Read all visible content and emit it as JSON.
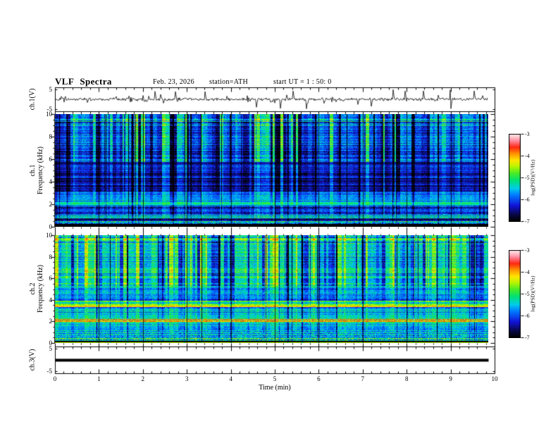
{
  "chart_data": {
    "type": "heatmap",
    "title": "VLF Spectra",
    "date": "Feb. 23, 2026",
    "station": "station=ATH",
    "start_ut": "start UT =  1 : 50: 0",
    "xlabel": "Time  (min)",
    "xlim": [
      0,
      10
    ],
    "xticks": [
      0,
      1,
      2,
      3,
      4,
      5,
      6,
      7,
      8,
      9,
      10
    ],
    "x_minor_step": 0.2,
    "data_duration_min": 9.85,
    "panels": [
      {
        "id": "ch1-waveform",
        "type": "line",
        "ylabel": "ch.1(V)",
        "ylim": [
          -6,
          6
        ],
        "yticks": [
          5,
          -5
        ],
        "description": "broadband noise around 0 V, ~±1 V, with sporadic impulses to ±5 V",
        "signal": {
          "baseline": 0,
          "noise_amp": 0.5,
          "spike_count": 26,
          "spike_amp_min": 1.5,
          "spike_amp_max": 5,
          "seed": 7
        }
      },
      {
        "id": "ch1-spectrogram",
        "type": "heatmap",
        "ylabel_lines": [
          "ch.1",
          "Frequency (kHz)"
        ],
        "ylim": [
          0,
          10
        ],
        "yticks": [
          0,
          2,
          4,
          6,
          8,
          10
        ],
        "y_minor_step": 0.5,
        "value_range": [
          -7,
          -3
        ],
        "seed": 11,
        "stripe_sign": 1,
        "bands": [
          [
            0.0,
            0.25,
            -7.0,
            0.1,
            0.0
          ],
          [
            0.25,
            0.5,
            -4.9,
            0.95,
            0.1
          ],
          [
            0.5,
            0.75,
            -6.3,
            0.5,
            0.1
          ],
          [
            0.75,
            1.05,
            -5.35,
            0.45,
            0.2
          ],
          [
            1.05,
            1.85,
            -5.9,
            0.5,
            0.3
          ],
          [
            1.85,
            2.15,
            -4.95,
            0.35,
            0.2
          ],
          [
            2.15,
            2.6,
            -5.55,
            0.35,
            0.3
          ],
          [
            2.6,
            3.1,
            -5.75,
            0.4,
            0.4
          ],
          [
            3.1,
            4.4,
            -6.45,
            0.35,
            0.5
          ],
          [
            4.4,
            5.5,
            -6.3,
            0.4,
            0.55
          ],
          [
            5.5,
            5.75,
            -6.6,
            0.3,
            0.35
          ],
          [
            5.75,
            9.0,
            -6.05,
            0.45,
            0.95
          ],
          [
            9.0,
            10.0,
            -5.65,
            0.55,
            0.95
          ]
        ]
      },
      {
        "id": "ch2-spectrogram",
        "type": "heatmap",
        "ylabel_lines": [
          "ch.2",
          "Frequency (kHz)"
        ],
        "ylim": [
          0,
          10
        ],
        "yticks": [
          0,
          2,
          4,
          6,
          8,
          10
        ],
        "y_minor_step": 0.5,
        "value_range": [
          -7,
          -3
        ],
        "seed": 23,
        "stripe_sign": -1,
        "bands": [
          [
            0.0,
            0.08,
            -4.4,
            0.3,
            0.0
          ],
          [
            0.08,
            0.2,
            -7.0,
            0.15,
            0.0
          ],
          [
            0.2,
            0.55,
            -5.3,
            0.85,
            0.1
          ],
          [
            0.55,
            1.1,
            -5.35,
            0.7,
            0.15
          ],
          [
            1.1,
            1.95,
            -5.45,
            0.45,
            0.25
          ],
          [
            1.95,
            2.25,
            -4.15,
            0.5,
            0.1
          ],
          [
            2.25,
            3.35,
            -5.35,
            0.45,
            0.3
          ],
          [
            3.35,
            3.6,
            -4.35,
            0.45,
            0.15
          ],
          [
            3.6,
            3.95,
            -5.0,
            0.4,
            0.25
          ],
          [
            3.95,
            4.65,
            -5.85,
            0.5,
            0.35
          ],
          [
            4.65,
            5.3,
            -5.5,
            0.45,
            0.45
          ],
          [
            5.3,
            9.2,
            -5.25,
            0.45,
            0.9
          ],
          [
            9.2,
            10.0,
            -5.0,
            0.6,
            0.85
          ]
        ]
      },
      {
        "id": "ch3-waveform",
        "type": "line",
        "ylabel": "ch.3(V)",
        "ylim": [
          -6,
          6
        ],
        "yticks": [
          5,
          -5
        ],
        "description": "flat line at 0 V (no signal), drawn thick",
        "signal": {
          "baseline": 0,
          "noise_amp": 0,
          "spike_count": 0,
          "line_width": 4,
          "seed": 3
        }
      }
    ],
    "colorbars": [
      {
        "label": "log(PSD)(V²/Hz)",
        "range": [
          -7,
          -3
        ],
        "ticks": [
          -3,
          -4,
          -5,
          -6,
          -7
        ]
      },
      {
        "label": "log(PSD)(V²/Hz)",
        "range": [
          -7,
          -3
        ],
        "ticks": [
          -3,
          -4,
          -5,
          -6,
          -7
        ]
      }
    ],
    "colormap": [
      [
        0.0,
        [
          0,
          0,
          0
        ]
      ],
      [
        0.08,
        [
          8,
          8,
          70
        ]
      ],
      [
        0.18,
        [
          18,
          18,
          215
        ]
      ],
      [
        0.3,
        [
          0,
          120,
          255
        ]
      ],
      [
        0.38,
        [
          0,
          205,
          235
        ]
      ],
      [
        0.47,
        [
          0,
          225,
          115
        ]
      ],
      [
        0.55,
        [
          70,
          235,
          40
        ]
      ],
      [
        0.63,
        [
          185,
          245,
          0
        ]
      ],
      [
        0.7,
        [
          255,
          230,
          0
        ]
      ],
      [
        0.78,
        [
          255,
          140,
          0
        ]
      ],
      [
        0.85,
        [
          255,
          40,
          20
        ]
      ],
      [
        0.92,
        [
          255,
          135,
          155
        ]
      ],
      [
        1.0,
        [
          255,
          238,
          238
        ]
      ]
    ],
    "grid": "minute tick lines overlaid on spectrograms",
    "legend_position": "right colorbars"
  }
}
